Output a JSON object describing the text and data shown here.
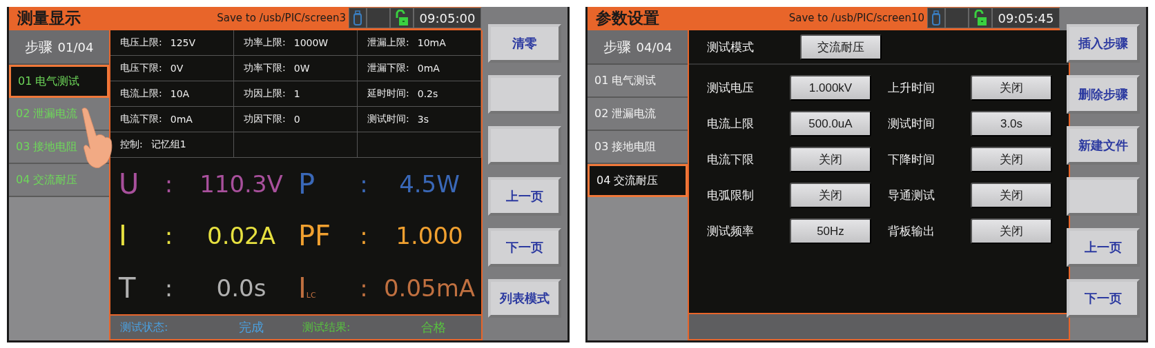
{
  "screens": [
    {
      "kind": "measure",
      "title": "测量显示",
      "save_path": "Save to /usb/PIC/screen3",
      "time": "09:05:00",
      "touch_pointer": true,
      "step_header": {
        "label": "步骤",
        "value": "01/04"
      },
      "steps": [
        {
          "label": "01 电气测试",
          "selected": true
        },
        {
          "label": "02 泄漏电流",
          "selected": false
        },
        {
          "label": "03 接地电阻",
          "selected": false
        },
        {
          "label": "04 交流耐压",
          "selected": false
        }
      ],
      "limits": [
        [
          {
            "label": "电压上限:",
            "value": "125V"
          },
          {
            "label": "功率上限:",
            "value": "1000W"
          },
          {
            "label": "泄漏上限:",
            "value": "10mA"
          }
        ],
        [
          {
            "label": "电压下限:",
            "value": "0V"
          },
          {
            "label": "功率下限:",
            "value": "0W"
          },
          {
            "label": "泄漏下限:",
            "value": "0mA"
          }
        ],
        [
          {
            "label": "电流上限:",
            "value": "10A"
          },
          {
            "label": "功因上限:",
            "value": "1"
          },
          {
            "label": "延时时间:",
            "value": "0.2s"
          }
        ],
        [
          {
            "label": "电流下限:",
            "value": "0mA"
          },
          {
            "label": "功因下限:",
            "value": "0"
          },
          {
            "label": "测试时间:",
            "value": "3s"
          }
        ],
        [
          {
            "label": "控制:",
            "value": "记忆组1"
          }
        ]
      ],
      "readings": [
        {
          "label": "U",
          "colon": ":",
          "value": "110.3V",
          "color": "#a8509c"
        },
        {
          "label": "P",
          "colon": ":",
          "value": "4.5W",
          "color": "#3a68b8"
        },
        {
          "label": "I",
          "colon": ":",
          "value": "0.02A",
          "color": "#e6e040"
        },
        {
          "label": "PF",
          "colon": ":",
          "value": "1.000",
          "color": "#f0a030"
        },
        {
          "label": "T",
          "colon": ":",
          "value": "0.0s",
          "color": "#b0b0b0"
        },
        {
          "label": "I$_{LC}$",
          "colon": ":",
          "value": "0.05mA",
          "color": "#c07040"
        }
      ],
      "status_bar": [
        {
          "label": "测试状态:",
          "value": "完成",
          "color": "#4aa0e0"
        },
        {
          "label": "测试结果:",
          "value": "合格",
          "color": "#58c040"
        }
      ],
      "buttons": [
        {
          "kind": "text",
          "label": "清零"
        },
        {
          "kind": "blank"
        },
        {
          "kind": "blank"
        },
        {
          "kind": "text",
          "label": "上一页"
        },
        {
          "kind": "text",
          "label": "下一页"
        },
        {
          "kind": "text",
          "label": "列表模式"
        }
      ]
    },
    {
      "kind": "settings",
      "title": "参数设置",
      "save_path": "Save to /usb/PIC/screen10",
      "time": "09:05:45",
      "touch_pointer": false,
      "step_header": {
        "label": "步骤",
        "value": "04/04"
      },
      "steps": [
        {
          "label": "01 电气测试",
          "selected": false
        },
        {
          "label": "02 泄漏电流",
          "selected": false
        },
        {
          "label": "03 接地电阻",
          "selected": false
        },
        {
          "label": "04 交流耐压",
          "selected": true
        }
      ],
      "mode": {
        "label": "测试模式",
        "value": "交流耐压"
      },
      "params": [
        [
          {
            "label": "测试电压",
            "value": "1.000kV"
          },
          {
            "label": "上升时间",
            "value": "关闭"
          }
        ],
        [
          {
            "label": "电流上限",
            "value": "500.0uA"
          },
          {
            "label": "测试时间",
            "value": "3.0s"
          }
        ],
        [
          {
            "label": "电流下限",
            "value": "关闭"
          },
          {
            "label": "下降时间",
            "value": "关闭"
          }
        ],
        [
          {
            "label": "电弧限制",
            "value": "关闭"
          },
          {
            "label": "导通测试",
            "value": "关闭"
          }
        ],
        [
          {
            "label": "测试频率",
            "value": "50Hz"
          },
          {
            "label": "背板输出",
            "value": "关闭"
          }
        ]
      ],
      "buttons": [
        {
          "kind": "text",
          "label": "插入步骤"
        },
        {
          "kind": "text",
          "label": "删除步骤"
        },
        {
          "kind": "text",
          "label": "新建文件"
        },
        {
          "kind": "blank"
        },
        {
          "kind": "text",
          "label": "上一页"
        },
        {
          "kind": "text",
          "label": "下一页"
        }
      ]
    }
  ]
}
